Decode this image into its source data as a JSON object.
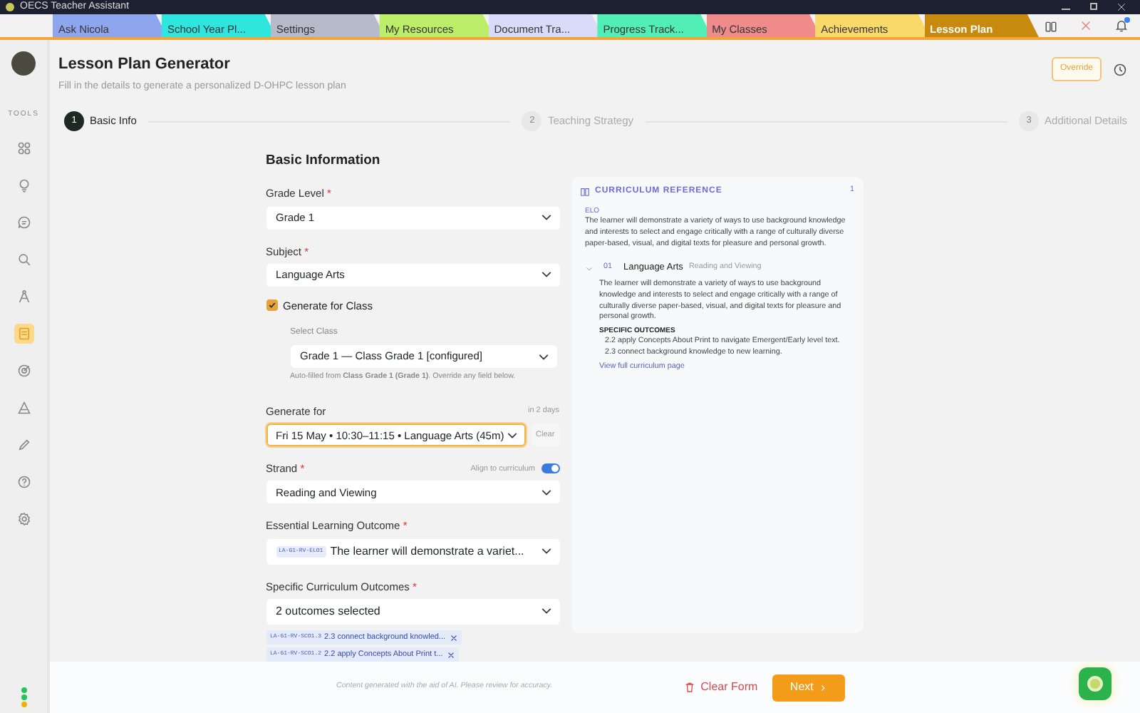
{
  "window": {
    "title": "OECS Teacher Assistant"
  },
  "tabs": [
    {
      "label": "Ask Nicola",
      "color": "#8fa6ee",
      "selected": false
    },
    {
      "label": "School Year Pl...",
      "color": "#2fe6df",
      "selected": false
    },
    {
      "label": "Settings",
      "color": "#b7bbc9",
      "selected": false
    },
    {
      "label": "My Resources",
      "color": "#bdee6a",
      "selected": false
    },
    {
      "label": "Document Tra...",
      "color": "#d9dcf8",
      "selected": false
    },
    {
      "label": "Progress Track...",
      "color": "#52eeb8",
      "selected": false
    },
    {
      "label": "My Classes",
      "color": "#ef8b8b",
      "selected": false
    },
    {
      "label": "Achievements",
      "color": "#fad96b",
      "selected": false
    },
    {
      "label": "Lesson Plan",
      "color": "#c8890f",
      "selected": true
    }
  ],
  "sidebar": {
    "tools_label": "TOOLS",
    "items": [
      {
        "selected": false
      },
      {
        "selected": false
      },
      {
        "selected": false
      },
      {
        "selected": false
      },
      {
        "selected": false
      },
      {
        "selected": true
      },
      {
        "selected": false
      },
      {
        "selected": false
      },
      {
        "selected": false
      },
      {
        "selected": false
      },
      {
        "selected": false
      }
    ],
    "status_dots": [
      {
        "color": "#22c55e"
      },
      {
        "color": "#22c55e"
      },
      {
        "color": "#eab308"
      }
    ]
  },
  "header": {
    "title": "Lesson Plan Generator",
    "subtitle": "Fill in the details to generate a personalized D-OHPC lesson plan",
    "override_button": "Override"
  },
  "steps": [
    {
      "number": "1",
      "label": "Basic Info",
      "selected": true
    },
    {
      "number": "2",
      "label": "Teaching Strategy",
      "selected": false
    },
    {
      "number": "3",
      "label": "Additional Details",
      "selected": false
    }
  ],
  "form": {
    "heading": "Basic Information",
    "grade_level": {
      "label": "Grade Level",
      "required_mark": "*",
      "value": "Grade 1"
    },
    "subject": {
      "label": "Subject",
      "required_mark": "*",
      "value": "Language Arts"
    },
    "generate_for_class": {
      "label": "Generate for Class",
      "checked": true
    },
    "select_class": {
      "label": "Select Class",
      "value": "Grade 1 — Class Grade 1 [configured]",
      "note": "Auto-filled from **Class Grade 1 (Grade 1)**. Override any field below."
    },
    "generate_for": {
      "label": "Generate for",
      "hint": "in 2 days",
      "value": "Fri 15 May • 10:30–11:15 • Language Arts (45m)",
      "focused": true,
      "clear_button": "Clear"
    },
    "strand": {
      "label": "Strand",
      "required_mark": "*",
      "toggle_label": "Align to curriculum",
      "toggle_on": true,
      "value": "Reading and Viewing"
    },
    "elo": {
      "label": "Essential Learning Outcome",
      "required_mark": "*",
      "code": "LA-G1-RV-ELO1",
      "value": "The learner will demonstrate a variet..."
    },
    "sco": {
      "label": "Specific Curriculum Outcomes",
      "required_mark": "*",
      "value": "2 outcomes selected",
      "chips": [
        {
          "code": "LA-G1-RV-SCO1.3",
          "text": "2.3 connect background knowled..."
        },
        {
          "code": "LA-G1-RV-SCO1.2",
          "text": "2.2 apply Concepts About Print t..."
        }
      ]
    }
  },
  "reference": {
    "title": "CURRICULUM REFERENCE",
    "count": "1",
    "elo_label": "ELO",
    "elo_text": "The learner will demonstrate a variety of ways to use background knowledge and interests to select and engage critically with a range of culturally diverse paper-based, visual, and digital texts for pleasure and personal growth.",
    "entry": {
      "number": "01",
      "subject": "Language Arts",
      "strand": "Reading and Viewing",
      "expanded": true,
      "text": "The learner will demonstrate a variety of ways to use background knowledge and interests to select and engage critically with a range of culturally diverse paper-based, visual, and digital texts for pleasure and personal growth.",
      "outcomes_heading": "SPECIFIC OUTCOMES",
      "outcomes": [
        "2.2 apply Concepts About Print to navigate Emergent/Early level text.",
        "2.3 connect background knowledge to new learning."
      ],
      "link": "View full curriculum page"
    }
  },
  "footer": {
    "disclaimer": "Content generated with the aid of AI. Please review for accuracy.",
    "clear_button": "Clear Form",
    "next_button": "Next"
  }
}
